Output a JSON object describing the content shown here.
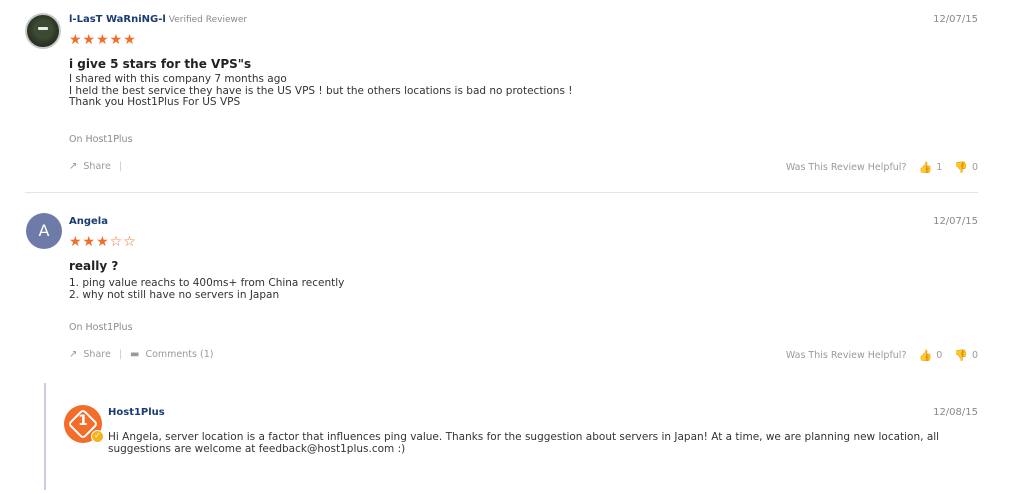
{
  "reviews": [
    {
      "author": "l-LasT WaRniNG-l",
      "badge": "Verified Reviewer",
      "date": "12/07/15",
      "stars": "★★★★★",
      "rating": 5,
      "title": "i give 5 stars for the VPS\"s",
      "body": "I shared with this company 7 months ago\nI held the best service they have is the US VPS ! but the others locations is bad no protections !\nThank you Host1Plus For US VPS",
      "source": "On Host1Plus",
      "share_label": "Share",
      "helpful_label": "Was This Review Helpful?",
      "helpful_up": "1",
      "helpful_down": "0"
    },
    {
      "author": "Angela",
      "avatar_letter": "A",
      "date": "12/07/15",
      "stars": "★★★☆☆",
      "rating": 3,
      "title": "really ?",
      "body": "1. ping value reachs to 400ms+ from China recently\n2. why not still have no servers in Japan",
      "source": "On Host1Plus",
      "share_label": "Share",
      "comments_label": "Comments (1)",
      "helpful_label": "Was This Review Helpful?",
      "helpful_up": "0",
      "helpful_down": "0"
    }
  ],
  "reply": {
    "author": "Host1Plus",
    "logo_digit": "1",
    "date": "12/08/15",
    "body": "Hi Angela, server location is a factor that influences ping value. Thanks for the suggestion about servers in Japan! At a time, we are planning new location, all\nsuggestions are welcome at feedback@host1plus.com :)"
  },
  "icons": {
    "share": "↗",
    "comment": "▬",
    "thumb_up": "👍",
    "thumb_down": "👎",
    "check": "✓"
  },
  "colors": {
    "accent": "#f26c2a",
    "name": "#1a3b73",
    "avatar_letter_bg": "#6e7ba8",
    "reply_bar": "#c9cde3"
  }
}
